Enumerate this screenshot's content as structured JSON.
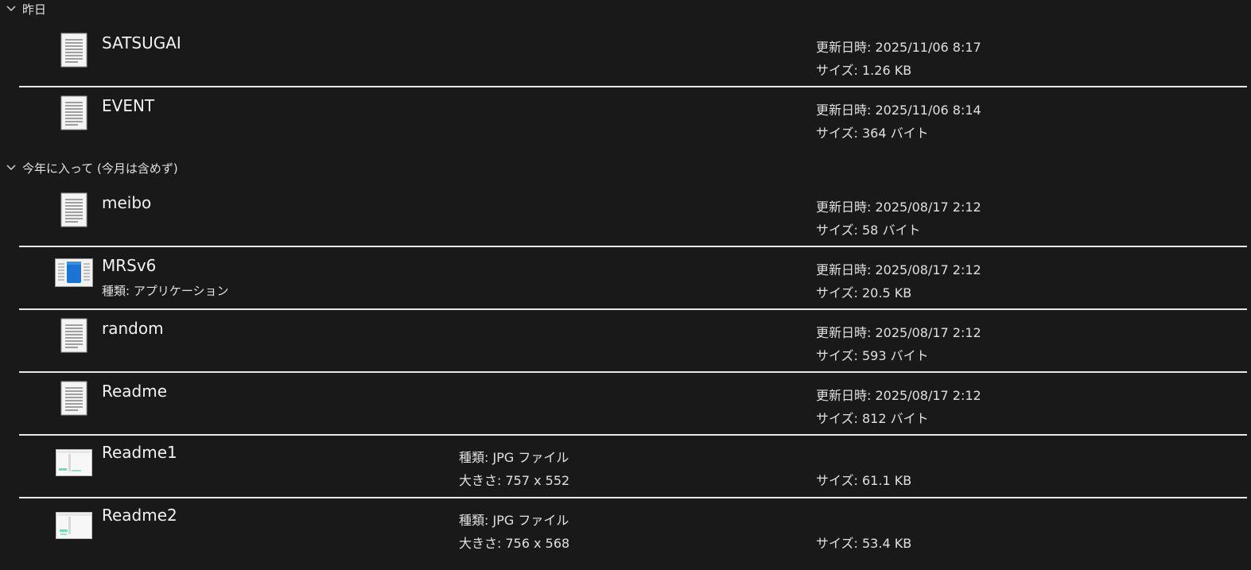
{
  "groups": [
    {
      "label": "昨日",
      "items": [
        {
          "name": "SATSUGAI",
          "icon": "text-file-icon",
          "modified": "更新日時: 2025/11/06 8:17",
          "size": "サイズ: 1.26 KB"
        },
        {
          "name": "EVENT",
          "icon": "text-file-icon",
          "modified": "更新日時: 2025/11/06 8:14",
          "size": "サイズ: 364 バイト"
        }
      ]
    },
    {
      "label": "今年に入って (今月は含めず)",
      "items": [
        {
          "name": "meibo",
          "icon": "text-file-icon",
          "modified": "更新日時: 2025/08/17 2:12",
          "size": "サイズ: 58 バイト"
        },
        {
          "name": "MRSv6",
          "icon": "application-icon",
          "kind": "種類: アプリケーション",
          "modified": "更新日時: 2025/08/17 2:12",
          "size": "サイズ: 20.5 KB"
        },
        {
          "name": "random",
          "icon": "text-file-icon",
          "modified": "更新日時: 2025/08/17 2:12",
          "size": "サイズ: 593 バイト"
        },
        {
          "name": "Readme",
          "icon": "text-file-icon",
          "modified": "更新日時: 2025/08/17 2:12",
          "size": "サイズ: 812 バイト"
        },
        {
          "name": "Readme1",
          "icon": "image-thumbnail-icon",
          "type": "種類: JPG ファイル",
          "dimensions": "大きさ: 757 x 552",
          "size": "サイズ: 61.1 KB"
        },
        {
          "name": "Readme2",
          "icon": "image-thumbnail-icon",
          "type": "種類: JPG ファイル",
          "dimensions": "大きさ: 756 x 568",
          "size": "サイズ: 53.4 KB"
        }
      ]
    }
  ],
  "colors": {
    "background": "#191919",
    "separator": "#e8e8e8",
    "text": "#e0e0e0"
  }
}
